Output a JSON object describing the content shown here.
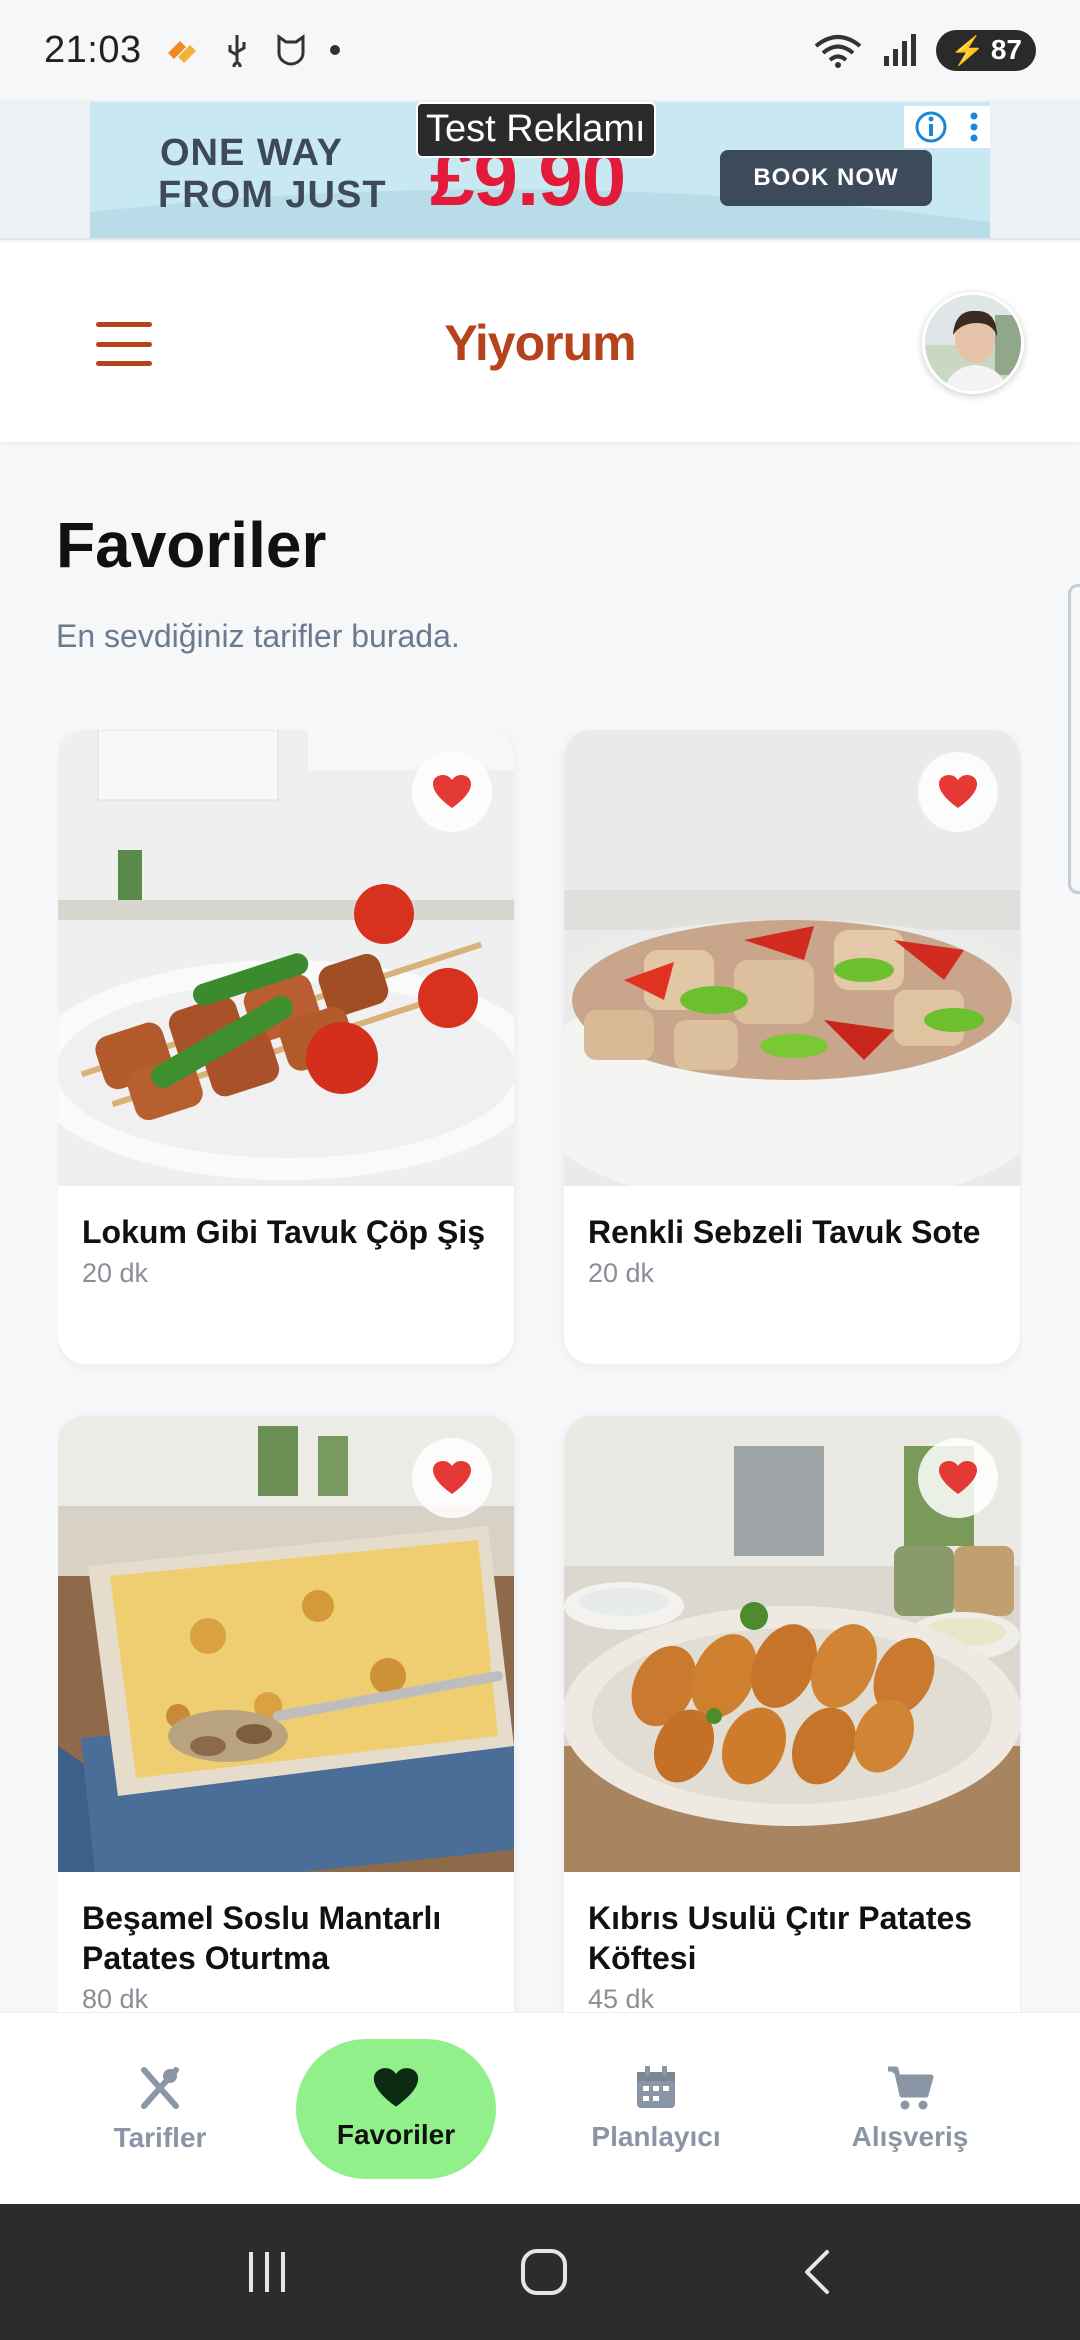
{
  "status_bar": {
    "time": "21:03",
    "battery": "87"
  },
  "ad": {
    "label": "Test Reklamı",
    "line1": "ONE WAY",
    "line2": "FROM JUST",
    "price": "£9.90",
    "cta": "BOOK NOW"
  },
  "header": {
    "app_title": "Yiyorum"
  },
  "page": {
    "title": "Favoriler",
    "subtitle": "En sevdiğiniz tarifler burada."
  },
  "recipes": [
    {
      "title": "Lokum Gibi Tavuk Çöp Şiş",
      "time": "20 dk"
    },
    {
      "title": "Renkli Sebzeli Tavuk Sote",
      "time": "20 dk"
    },
    {
      "title": "Beşamel Soslu Mantarlı Patates Oturtma",
      "time": "80 dk"
    },
    {
      "title": "Kıbrıs Usulü Çıtır Patates Köftesi",
      "time": "45 dk"
    }
  ],
  "bottom_nav": [
    {
      "label": "Tarifler",
      "icon": "utensils-icon",
      "active": false
    },
    {
      "label": "Favoriler",
      "icon": "heart-icon",
      "active": true
    },
    {
      "label": "Planlayıcı",
      "icon": "calendar-icon",
      "active": false
    },
    {
      "label": "Alışveriş",
      "icon": "cart-icon",
      "active": false
    }
  ],
  "colors": {
    "brand": "#b5431b",
    "heart": "#e53935",
    "active_nav": "#92f08a",
    "muted_text": "#8a96a6"
  }
}
